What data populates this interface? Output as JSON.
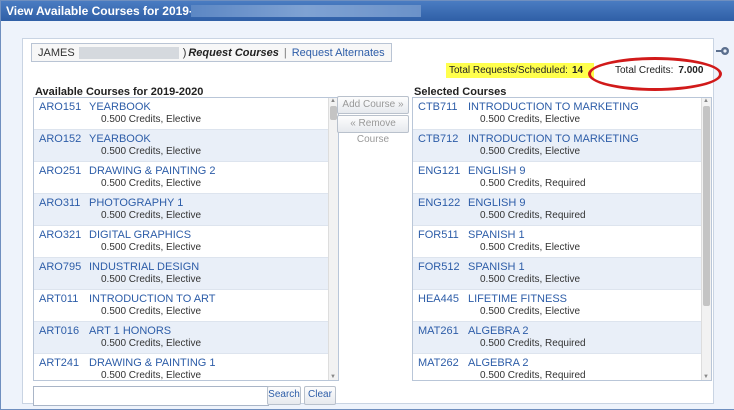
{
  "window": {
    "title": "View Available Courses for 2019-2020 in"
  },
  "tabs": {
    "student_name": "JAMES",
    "name_suffix": ")",
    "request_courses": "Request Courses",
    "separator": "|",
    "request_alternates": "Request Alternates"
  },
  "totals": {
    "requests_label": "Total Requests/Scheduled:",
    "requests_value": "14",
    "credits_label": "Total Credits:",
    "credits_value": "7.000"
  },
  "available": {
    "heading": "Available Courses for 2019-2020",
    "courses": [
      {
        "code": "ARO151",
        "title": "YEARBOOK",
        "detail": "0.500 Credits,  Elective"
      },
      {
        "code": "ARO152",
        "title": "YEARBOOK",
        "detail": "0.500 Credits,  Elective"
      },
      {
        "code": "ARO251",
        "title": "DRAWING & PAINTING 2",
        "detail": "0.500 Credits,  Elective"
      },
      {
        "code": "ARO311",
        "title": "PHOTOGRAPHY 1",
        "detail": "0.500 Credits,  Elective"
      },
      {
        "code": "ARO321",
        "title": "DIGITAL GRAPHICS",
        "detail": "0.500 Credits,  Elective"
      },
      {
        "code": "ARO795",
        "title": "INDUSTRIAL DESIGN",
        "detail": "0.500 Credits,  Elective"
      },
      {
        "code": "ART011",
        "title": "INTRODUCTION TO ART",
        "detail": "0.500 Credits,  Elective"
      },
      {
        "code": "ART016",
        "title": "ART 1 HONORS",
        "detail": "0.500 Credits,  Elective"
      },
      {
        "code": "ART241",
        "title": "DRAWING & PAINTING 1",
        "detail": "0.500 Credits,  Elective"
      }
    ]
  },
  "selected": {
    "heading": "Selected Courses",
    "courses": [
      {
        "code": "CTB711",
        "title": "INTRODUCTION TO MARKETING",
        "detail": "0.500 Credits,  Elective"
      },
      {
        "code": "CTB712",
        "title": "INTRODUCTION TO MARKETING",
        "detail": "0.500 Credits,  Elective"
      },
      {
        "code": "ENG121",
        "title": "ENGLISH 9",
        "detail": "0.500 Credits,  Required"
      },
      {
        "code": "ENG122",
        "title": "ENGLISH 9",
        "detail": "0.500 Credits,  Required"
      },
      {
        "code": "FOR511",
        "title": "SPANISH 1",
        "detail": "0.500 Credits,  Elective"
      },
      {
        "code": "FOR512",
        "title": "SPANISH 1",
        "detail": "0.500 Credits,  Elective"
      },
      {
        "code": "HEA445",
        "title": "LIFETIME FITNESS",
        "detail": "0.500 Credits,  Elective"
      },
      {
        "code": "MAT261",
        "title": "ALGEBRA 2",
        "detail": "0.500 Credits,  Required"
      },
      {
        "code": "MAT262",
        "title": "ALGEBRA 2",
        "detail": "0.500 Credits,  Required"
      }
    ]
  },
  "actions": {
    "add_course": "Add Course »",
    "remove_course": "« Remove Course"
  },
  "search": {
    "value": "",
    "search_label": "Search",
    "clear_label": "Clear"
  },
  "colors": {
    "accent": "#2d5da8",
    "highlight": "#ffff4d",
    "annotation": "#d11a1a"
  }
}
